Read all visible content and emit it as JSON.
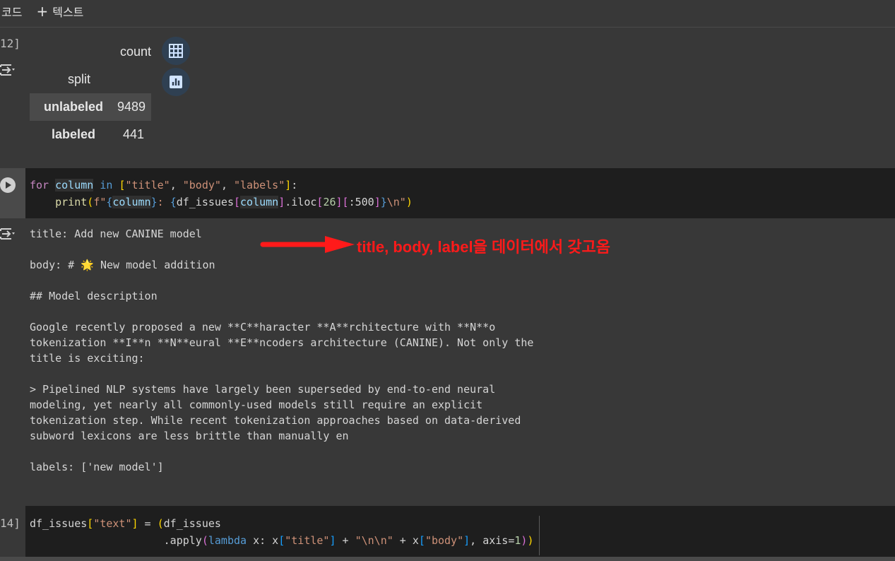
{
  "toolbar": {
    "code_label": "코드",
    "text_label": "텍스트",
    "plus": "+"
  },
  "cells": {
    "out1_num": "12]",
    "cell2_num": "14]"
  },
  "dataframe": {
    "col_header": "count",
    "index_name": "split",
    "rows": [
      {
        "index": "unlabeled",
        "count": "9489"
      },
      {
        "index": "labeled",
        "count": "441"
      }
    ]
  },
  "code1": {
    "line1_tokens": [
      "for",
      " ",
      "column",
      " ",
      "in",
      " ",
      "[",
      "\"title\"",
      ", ",
      "\"body\"",
      ", ",
      "\"labels\"",
      "]",
      ":"
    ],
    "line2_pre": "    ",
    "print": "print",
    "fprefix": "f\"",
    "brace_open": "{",
    "column": "column",
    "brace_close": "}",
    "colon_sp": ": ",
    "df": "df_issues",
    "col2": "column",
    "iloc": ".iloc",
    "idx26": "26",
    "slice": ":500",
    "esc": "\\n\"",
    "close": ")"
  },
  "output2": {
    "lines": [
      "title: Add new CANINE model",
      "",
      "body: # 🌟 New model addition",
      "",
      "## Model description",
      "",
      "Google recently proposed a new **C**haracter **A**rchitecture with **N**o",
      "tokenization **I**n **N**eural **E**ncoders architecture (CANINE). Not only the",
      "title is exciting:",
      "",
      "> Pipelined NLP systems have largely been superseded by end-to-end neural",
      "modeling, yet nearly all commonly-used models still require an explicit",
      "tokenization step. While recent tokenization approaches based on data-derived",
      "subword lexicons are less brittle than manually en",
      "",
      "labels: ['new model']"
    ]
  },
  "annotation": {
    "text": "title, body, label을 데이터에서 갖고옴",
    "color": "#ff1a1a"
  },
  "code2": {
    "line1_a": "df_issues",
    "line1_b": "[",
    "line1_c": "\"text\"",
    "line1_d": "]",
    "line1_e": " = ",
    "line1_f": "(",
    "line1_g": "df_issues",
    "line2_pad": "                     ",
    "line2_apply": ".apply",
    "line2_p": "(",
    "line2_lambda": "lambda",
    "line2_x": " x: x",
    "line2_b1": "[",
    "line2_title": "\"title\"",
    "line2_b2": "]",
    "line2_plus": " + ",
    "line2_nn": "\"\\n\\n\"",
    "line2_plus2": " + x",
    "line2_b3": "[",
    "line2_body": "\"body\"",
    "line2_b4": "]",
    "line2_axis": ", axis=",
    "line2_one": "1",
    "line2_end1": ")",
    "line2_end2": ")"
  }
}
